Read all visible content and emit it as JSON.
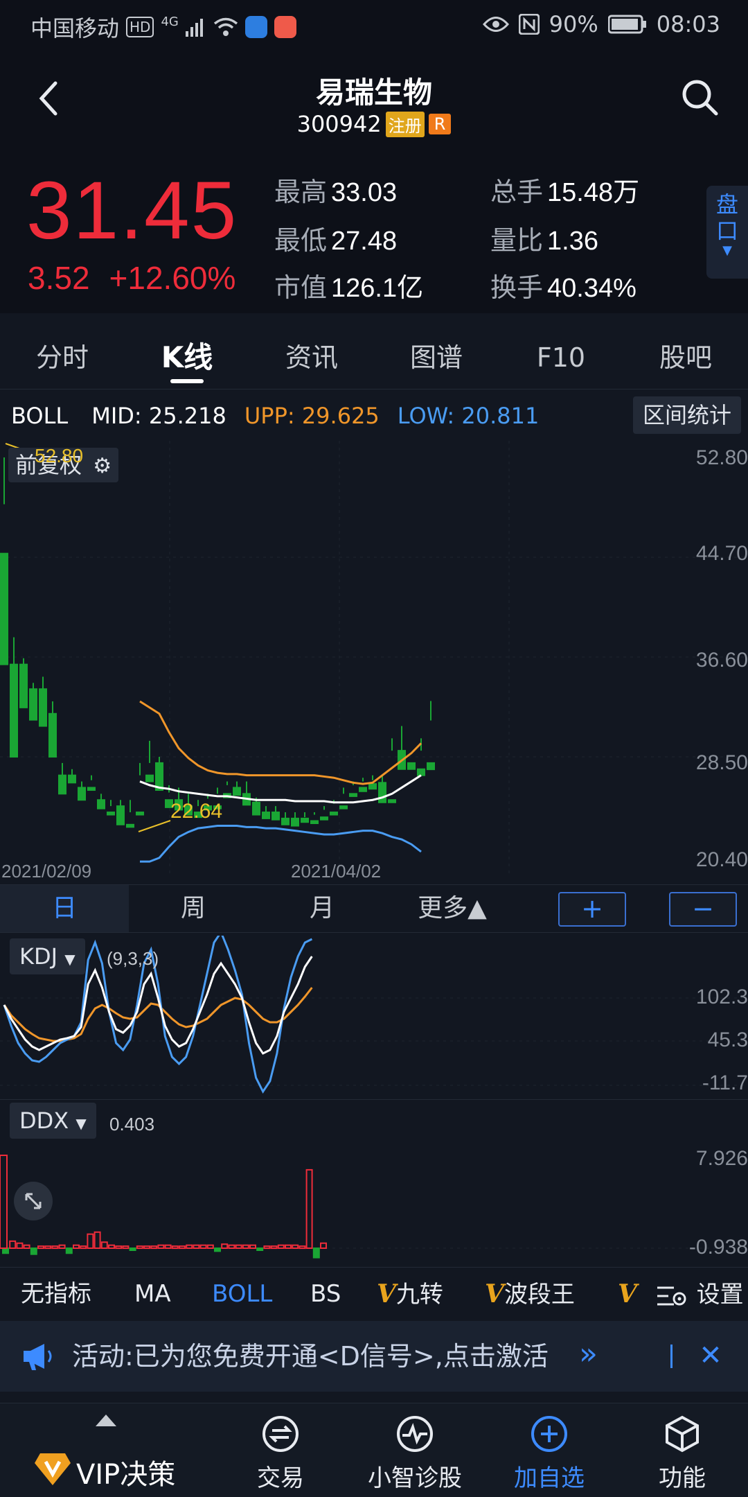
{
  "status_bar": {
    "carrier": "中国移动",
    "hd": "HD",
    "network": "4G",
    "battery": "90%",
    "time": "08:03"
  },
  "header": {
    "name": "易瑞生物",
    "code": "300942",
    "tag_registered": "注册",
    "tag_r": "R"
  },
  "quote": {
    "price": "31.45",
    "change": "3.52",
    "change_pct": "+12.60%",
    "fields": {
      "high_label": "最高",
      "high": "33.03",
      "low_label": "最低",
      "low": "27.48",
      "cap_label": "市值",
      "cap": "126.1亿",
      "vol_label": "总手",
      "vol": "15.48万",
      "ratio_label": "量比",
      "ratio": "1.36",
      "turnover_label": "换手",
      "turnover": "40.34%"
    },
    "pankou": "盘口"
  },
  "tabs": [
    "分时",
    "K线",
    "资讯",
    "图谱",
    "F10",
    "股吧"
  ],
  "boll": {
    "name": "BOLL",
    "mid": "MID: 25.218",
    "upp": "UPP: 29.625",
    "low": "LOW: 20.811",
    "range_btn": "区间统计"
  },
  "kchart": {
    "fq_label": "前复权",
    "y_labels": [
      "52.80",
      "44.70",
      "36.60",
      "28.50",
      "20.40"
    ],
    "x_labels": [
      "2021/02/09",
      "2021/04/02"
    ],
    "high_mark": "52.80",
    "low_mark": "22.64"
  },
  "periods": [
    "日",
    "周",
    "月",
    "更多▲"
  ],
  "zoom": {
    "plus": "+",
    "minus": "−"
  },
  "kdj": {
    "name": "KDJ",
    "params": "(9,3,3)",
    "y_labels": [
      "102.3",
      "45.3",
      "-11.7"
    ]
  },
  "ddx": {
    "name": "DDX",
    "value": "0.403",
    "y_labels": [
      "7.926",
      "-0.938"
    ]
  },
  "indicators": [
    "无指标",
    "MA",
    "BOLL",
    "BS",
    "九转",
    "波段王",
    "设置"
  ],
  "promo": {
    "text": "活动:已为您免费开通<D信号>,点击激活"
  },
  "nav": {
    "vip": "VIP决策",
    "trade": "交易",
    "diagnose": "小智诊股",
    "add": "加自选",
    "func": "功能"
  },
  "colors": {
    "up": "#ee2c3a",
    "down": "#1aa634",
    "accent": "#3d8bff",
    "boll_mid": "#ffffff",
    "boll_upp": "#f0962a",
    "boll_low": "#4a9cf2"
  },
  "chart_data": {
    "type": "candlestick",
    "series": [
      {
        "name": "K",
        "values": [
          [
            45,
            52.8,
            49,
            36
          ],
          [
            36,
            38.2,
            30,
            28.5
          ],
          [
            36,
            36.5,
            33,
            32.5
          ],
          [
            34,
            34.5,
            32,
            31.5
          ],
          [
            34,
            35,
            33.5,
            31
          ],
          [
            32,
            33,
            29,
            28.5
          ],
          [
            27,
            28,
            26.5,
            25.5
          ],
          [
            27,
            27.5,
            26.8,
            26.4
          ],
          [
            26,
            26.5,
            25.5,
            25
          ],
          [
            26,
            27,
            26.6,
            25.8
          ],
          [
            25,
            25.5,
            24.8,
            24.3
          ],
          [
            24,
            25,
            24.5,
            23.8
          ],
          [
            24.5,
            25,
            23.2,
            23
          ],
          [
            23,
            25,
            24,
            22.8
          ],
          [
            24,
            28,
            27,
            23.8
          ],
          [
            27,
            29.8,
            28,
            26.5
          ],
          [
            28,
            28.5,
            26,
            25.8
          ],
          [
            25,
            26.2,
            25.6,
            24.4
          ],
          [
            25,
            26,
            24.5,
            24.2
          ],
          [
            24.5,
            25.5,
            24.1,
            23.8
          ],
          [
            24,
            25,
            24.5,
            23.6
          ],
          [
            24.5,
            25.5,
            25.1,
            24.2
          ],
          [
            24.5,
            26,
            25.5,
            24.3
          ],
          [
            25.5,
            26.5,
            26.2,
            25.2
          ],
          [
            26,
            26.5,
            25.5,
            25.4
          ],
          [
            25.5,
            26.5,
            24.8,
            24.6
          ],
          [
            24.8,
            25.2,
            24,
            23.8
          ],
          [
            24,
            24.5,
            23.8,
            23.5
          ],
          [
            24,
            24.5,
            23.6,
            23.4
          ],
          [
            23.5,
            24,
            23.2,
            23
          ],
          [
            23.5,
            24,
            23.1,
            22.9
          ],
          [
            23.5,
            24,
            23.6,
            23.2
          ],
          [
            23.3,
            24,
            23.8,
            23.1
          ],
          [
            23.6,
            24.5,
            24.2,
            23.4
          ],
          [
            24,
            25,
            24.7,
            23.8
          ],
          [
            24.5,
            26,
            25.5,
            24.3
          ],
          [
            25.5,
            26.5,
            26.2,
            25.3
          ],
          [
            26,
            26.8,
            26.5,
            25.7
          ],
          [
            26.3,
            27,
            26.6,
            25.9
          ],
          [
            26.4,
            27,
            25,
            24.8
          ],
          [
            25,
            30,
            29,
            24.8
          ],
          [
            29,
            31,
            28,
            27.5
          ],
          [
            28,
            31,
            31,
            27.5
          ],
          [
            27.5,
            30,
            29,
            27
          ],
          [
            28,
            33.03,
            31.45,
            27.48
          ]
        ]
      },
      {
        "name": "MID",
        "values": [
          26.5,
          26.2,
          26,
          25.9,
          25.7,
          25.6,
          25.5,
          25.4,
          25.3,
          25.3,
          25.2,
          25.1,
          25.0,
          25.0,
          25.0,
          25.0,
          24.9,
          24.9,
          24.9,
          24.9,
          24.8,
          24.8,
          24.8,
          24.9,
          25.0,
          25.2,
          25.5,
          26.0,
          26.5,
          27.0
        ]
      },
      {
        "name": "UPP",
        "values": [
          33,
          32.5,
          32,
          30.5,
          29.2,
          28.4,
          27.8,
          27.4,
          27.2,
          27.1,
          27.1,
          27.0,
          27.0,
          27.0,
          27.0,
          27.0,
          27.0,
          27.0,
          27.0,
          26.9,
          26.8,
          26.6,
          26.4,
          26.3,
          26.4,
          27.0,
          27.6,
          28.2,
          28.8,
          29.6
        ]
      },
      {
        "name": "LOW",
        "values": [
          20,
          20,
          20.3,
          21.2,
          22.0,
          22.4,
          22.7,
          22.8,
          22.9,
          22.9,
          22.9,
          22.8,
          22.8,
          22.7,
          22.7,
          22.6,
          22.5,
          22.4,
          22.3,
          22.2,
          22.2,
          22.3,
          22.4,
          22.5,
          22.5,
          22.3,
          22.0,
          21.8,
          21.4,
          20.8
        ]
      }
    ],
    "ylim": [
      20.4,
      52.8
    ]
  }
}
